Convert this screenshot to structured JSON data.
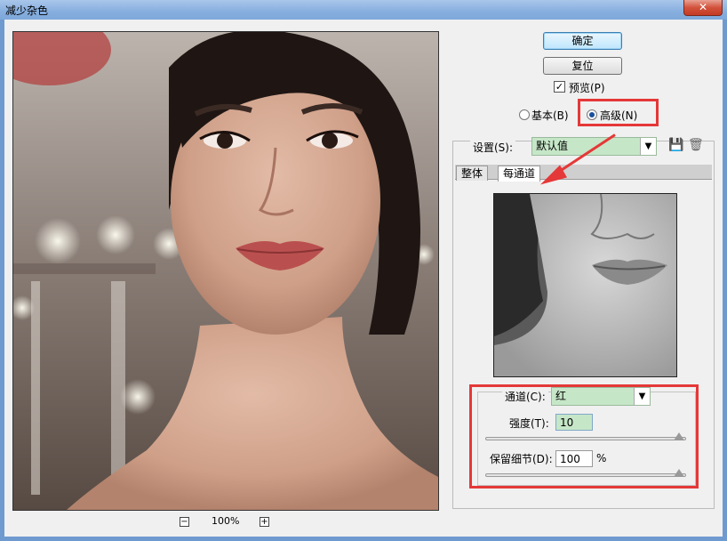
{
  "window": {
    "title": "减少杂色",
    "close_glyph": "✕"
  },
  "buttons": {
    "ok": "确定",
    "reset": "复位"
  },
  "preview_toggle": {
    "label": "预览(P)",
    "checked": true,
    "check_glyph": "✓"
  },
  "mode": {
    "basic_label": "基本(B)",
    "advanced_label": "高级(N)",
    "selected": "advanced"
  },
  "settings": {
    "label": "设置(S):",
    "value": "默认值",
    "save_icon": "💾",
    "trash_icon": "🗑"
  },
  "tabs": [
    {
      "label": "整体",
      "active": false
    },
    {
      "label": "每通道",
      "active": true
    }
  ],
  "channel": {
    "label": "通道(C):",
    "value": "红",
    "strength_label": "强度(T):",
    "strength_value": "10",
    "strength_max": 10,
    "detail_label": "保留细节(D):",
    "detail_value": "100",
    "detail_unit": "%",
    "detail_max": 100
  },
  "zoom": {
    "minus": "−",
    "plus": "+",
    "level": "100%"
  },
  "colors": {
    "highlight_red": "#e53838",
    "select_fill": "#c6e6c8",
    "dialog_bg": "#f0f0f0"
  }
}
